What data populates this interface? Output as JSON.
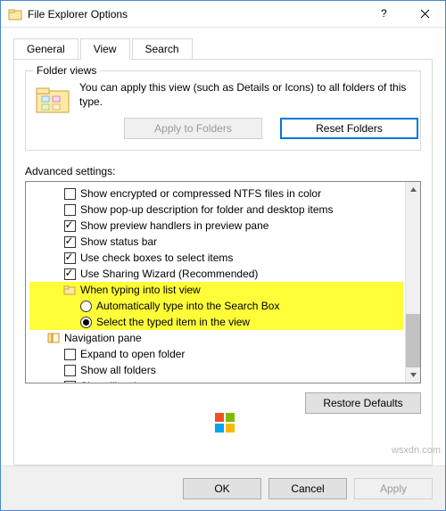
{
  "window": {
    "title": "File Explorer Options"
  },
  "tabs": {
    "general": "General",
    "view": "View",
    "search": "Search"
  },
  "folder_views": {
    "legend": "Folder views",
    "description": "You can apply this view (such as Details or Icons) to all folders of this type.",
    "apply_btn": "Apply to Folders",
    "reset_btn": "Reset Folders"
  },
  "advanced": {
    "label": "Advanced settings:",
    "items": [
      {
        "indent": 1,
        "control": "checkbox",
        "checked": false,
        "label": "Show encrypted or compressed NTFS files in color",
        "hl": false
      },
      {
        "indent": 1,
        "control": "checkbox",
        "checked": false,
        "label": "Show pop-up description for folder and desktop items",
        "hl": false
      },
      {
        "indent": 1,
        "control": "checkbox",
        "checked": true,
        "label": "Show preview handlers in preview pane",
        "hl": false
      },
      {
        "indent": 1,
        "control": "checkbox",
        "checked": true,
        "label": "Show status bar",
        "hl": false
      },
      {
        "indent": 1,
        "control": "checkbox",
        "checked": true,
        "label": "Use check boxes to select items",
        "hl": false
      },
      {
        "indent": 1,
        "control": "checkbox",
        "checked": true,
        "label": "Use Sharing Wizard (Recommended)",
        "hl": false
      },
      {
        "indent": 1,
        "control": "folder",
        "checked": false,
        "label": "When typing into list view",
        "hl": true
      },
      {
        "indent": 2,
        "control": "radio",
        "checked": false,
        "label": "Automatically type into the Search Box",
        "hl": true
      },
      {
        "indent": 2,
        "control": "radio",
        "checked": true,
        "label": "Select the typed item in the view",
        "hl": true
      },
      {
        "indent": 0,
        "control": "navpane",
        "checked": false,
        "label": "Navigation pane",
        "hl": false
      },
      {
        "indent": 1,
        "control": "checkbox",
        "checked": false,
        "label": "Expand to open folder",
        "hl": false
      },
      {
        "indent": 1,
        "control": "checkbox",
        "checked": false,
        "label": "Show all folders",
        "hl": false
      },
      {
        "indent": 1,
        "control": "checkbox",
        "checked": false,
        "label": "Show libraries",
        "hl": false
      }
    ],
    "restore_btn": "Restore Defaults"
  },
  "bottom": {
    "ok": "OK",
    "cancel": "Cancel",
    "apply": "Apply"
  },
  "watermark": "wsxdn.com"
}
